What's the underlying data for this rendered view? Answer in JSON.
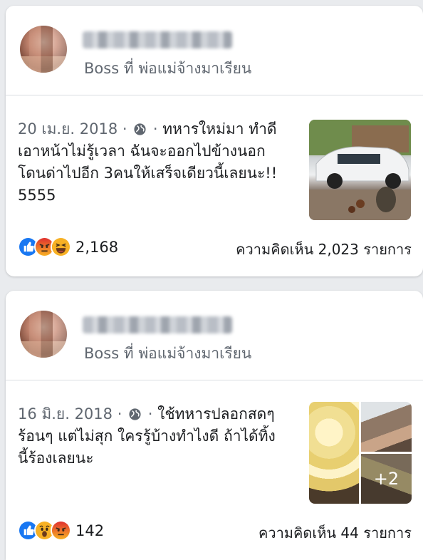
{
  "posts": [
    {
      "subtitle": "Boss ที่ พ่อแม่จ้างมาเรียน",
      "date": "20 เม.ย. 2018",
      "separator_1": " · ",
      "separator_2": " · ",
      "text_line_1": "ทหารใหม่มา ทำดี",
      "text_line_2": "เอาหน้าไม่รู้เวลา ฉันจะออกไปข้างนอก",
      "text_line_3": "โดนด่าไปอีก 3คนให้เสร็จเดียวนี้เลยนะ!!",
      "text_line_4": "5555",
      "reactions": [
        "like-icon",
        "angry-icon",
        "haha-icon"
      ],
      "reaction_count": "2,168",
      "comments": "ความคิดเห็น 2,023 รายการ"
    },
    {
      "subtitle": "Boss ที่ พ่อแม่จ้างมาเรียน",
      "date": "16 มิ.ย. 2018",
      "separator_1": " · ",
      "separator_2": " · ",
      "text_line_1": "ใช้ทหารปลอกสดๆ",
      "text_line_2": "ร้อนๆ แต่ไม่สุก ใครรู้บ้างทำไงดี ถ้าได้ทิ้ง",
      "text_line_3": "นี้ร้องเลยนะ",
      "extra_photos": "+2",
      "reactions": [
        "like-icon",
        "wow-icon",
        "angry-icon"
      ],
      "reaction_count": "142",
      "comments": "ความคิดเห็น 44 รายการ"
    }
  ],
  "colors": {
    "background": "#e9ebee",
    "card": "#ffffff",
    "meta_text": "#606770",
    "like_blue": "#1877f2",
    "angry_orange": "#e9710f",
    "haha_yellow": "#f7b125"
  }
}
